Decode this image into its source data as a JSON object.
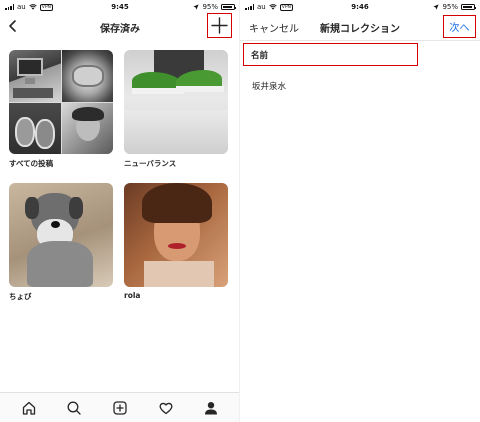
{
  "left": {
    "status": {
      "carrier": "au",
      "time": "9:45",
      "battery": "95%",
      "network_badge": "VPN"
    },
    "nav": {
      "title": "保存済み",
      "back_icon": "chevron-left-icon",
      "add_icon": "plus-icon"
    },
    "collections": [
      {
        "label": "すべての投稿"
      },
      {
        "label": "ニューバランス"
      },
      {
        "label": "ちょび"
      },
      {
        "label": "rola"
      }
    ],
    "tabbar": [
      "home-icon",
      "search-icon",
      "new-post-icon",
      "heart-icon",
      "profile-icon"
    ]
  },
  "right": {
    "status": {
      "carrier": "au",
      "time": "9:46",
      "battery": "95%",
      "network_badge": "VPN"
    },
    "nav": {
      "cancel_label": "キャンセル",
      "title": "新規コレクション",
      "next_label": "次へ"
    },
    "form": {
      "name_label": "名前",
      "saved_name": "坂井泉水"
    }
  },
  "colors": {
    "highlight": "#d40000",
    "link": "#1a6fe0",
    "text": "#262626"
  }
}
